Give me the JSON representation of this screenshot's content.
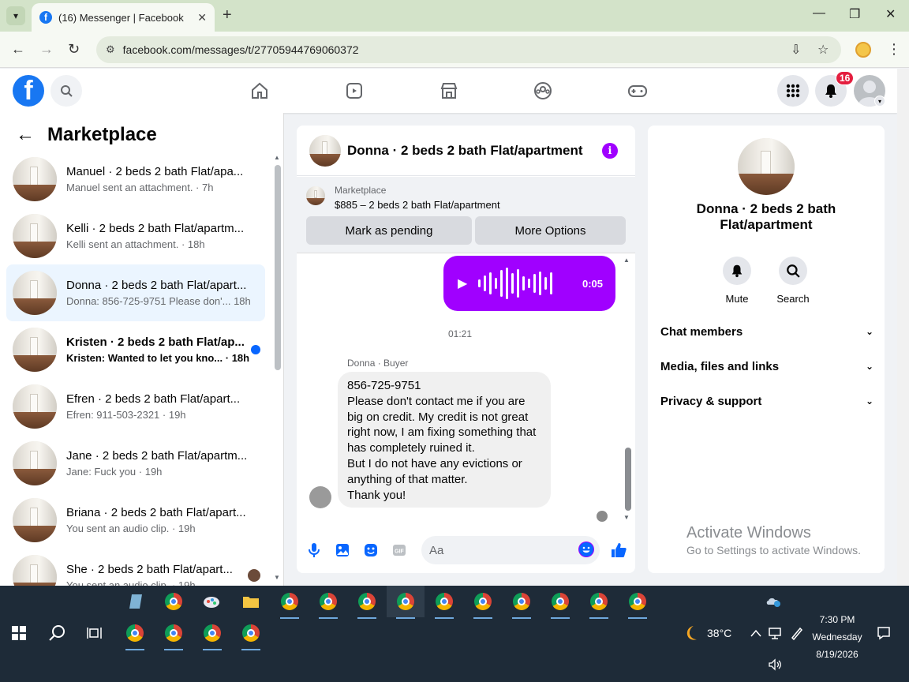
{
  "browser": {
    "tab_title": "(16) Messenger | Facebook",
    "url": "facebook.com/messages/t/27705944769060372"
  },
  "fb_header": {
    "notification_count": "16"
  },
  "left_panel": {
    "title": "Marketplace",
    "conversations": [
      {
        "name": "Manuel · 2 beds 2 bath Flat/apa...",
        "preview": "Manuel sent an attachment. · 7h"
      },
      {
        "name": "Kelli · 2 beds 2 bath Flat/apartm...",
        "preview": "Kelli sent an attachment. · 18h"
      },
      {
        "name": "Donna · 2 beds 2 bath Flat/apart...",
        "preview": "Donna: 856-725-9751 Please don'... 18h"
      },
      {
        "name": "Kristen · 2 beds 2 bath Flat/ap...",
        "preview": "Kristen: Wanted to let you kno... · 18h"
      },
      {
        "name": "Efren · 2 beds 2 bath Flat/apart...",
        "preview": "Efren: 911-503-2321 · 19h"
      },
      {
        "name": "Jane · 2 beds 2 bath Flat/apartm...",
        "preview": "Jane: Fuck you · 19h"
      },
      {
        "name": "Briana · 2 beds 2 bath Flat/apart...",
        "preview": "You sent an audio clip. · 19h"
      },
      {
        "name": "She · 2 beds 2 bath Flat/apart...",
        "preview": "You sent an audio clip. · 19h"
      }
    ]
  },
  "chat": {
    "title": "Donna · 2 beds 2 bath Flat/apartment",
    "marketplace_label": "Marketplace",
    "listing": "$885 – 2 beds 2 bath Flat/apartment",
    "mark_pending": "Mark as pending",
    "more_options": "More Options",
    "audio_duration": "0:05",
    "time_separator": "01:21",
    "sender_label": "Donna · Buyer",
    "message_lines": [
      "856-725-9751",
      "Please don't contact me if you are",
      "big on credit. My credit is not great",
      "right now, I am fixing something that",
      "has completely ruined it.",
      "But I do not have any evictions or",
      "anything of that matter.",
      "Thank you!"
    ],
    "input_placeholder": "Aa"
  },
  "right_panel": {
    "name": "Donna · 2 beds 2 bath Flat/apartment",
    "mute_label": "Mute",
    "search_label": "Search",
    "sections": [
      "Chat members",
      "Media, files and links",
      "Privacy & support"
    ]
  },
  "watermark": {
    "line1": "Activate Windows",
    "line2": "Go to Settings to activate Windows."
  },
  "taskbar": {
    "temperature": "38°C",
    "time": "7:30 PM",
    "day": "Wednesday",
    "date": "8/19/2026"
  }
}
